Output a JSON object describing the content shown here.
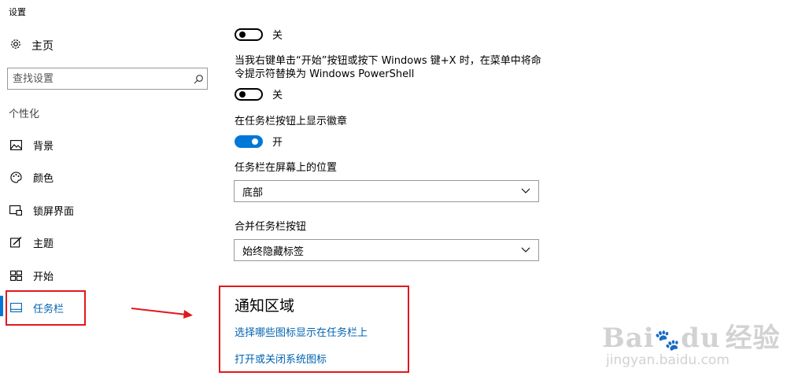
{
  "window": {
    "title": "设置"
  },
  "sidebar": {
    "home_label": "主页",
    "search_placeholder": "查找设置",
    "section_header": "个性化",
    "items": [
      {
        "label": "背景",
        "icon": "picture-icon"
      },
      {
        "label": "颜色",
        "icon": "palette-icon"
      },
      {
        "label": "锁屏界面",
        "icon": "lockscreen-icon"
      },
      {
        "label": "主题",
        "icon": "theme-icon"
      },
      {
        "label": "开始",
        "icon": "start-icon"
      },
      {
        "label": "任务栏",
        "icon": "taskbar-icon",
        "selected": true
      }
    ]
  },
  "main": {
    "toggle1": {
      "state": "关",
      "on": false
    },
    "powershell_label": "当我右键单击“开始”按钮或按下 Windows 键+X 时，在菜单中将命令提示符替换为 Windows PowerShell",
    "toggle2": {
      "state": "关",
      "on": false
    },
    "badges_label": "在任务栏按钮上显示徽章",
    "toggle3": {
      "state": "开",
      "on": true
    },
    "position_label": "任务栏在屏幕上的位置",
    "position_value": "底部",
    "combine_label": "合并任务栏按钮",
    "combine_value": "始终隐藏标签",
    "notification_title": "通知区域",
    "link1": "选择哪些图标显示在任务栏上",
    "link2": "打开或关闭系统图标"
  },
  "watermark": {
    "brand": "Bai",
    "brand2": "du",
    "cn": "经验",
    "url": "jingyan.baidu.com"
  },
  "colors": {
    "accent": "#0078d7",
    "link": "#0063b1",
    "annotation_red": "#e0191c"
  }
}
